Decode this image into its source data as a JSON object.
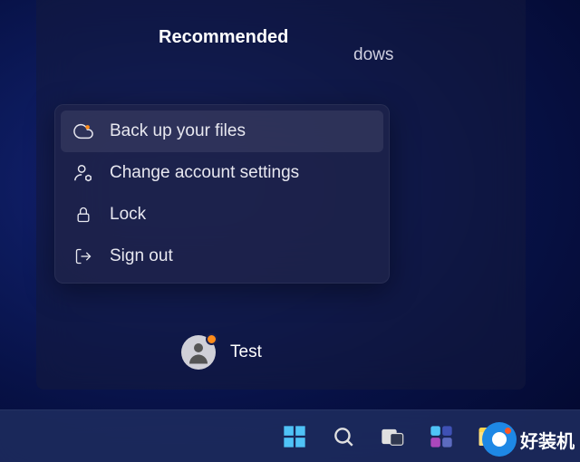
{
  "start": {
    "section_title": "Recommended",
    "partial_visible": "dows"
  },
  "menu": {
    "items": [
      {
        "id": "backup",
        "label": "Back up your files",
        "highlighted": true
      },
      {
        "id": "account",
        "label": "Change account settings",
        "highlighted": false
      },
      {
        "id": "lock",
        "label": "Lock",
        "highlighted": false
      },
      {
        "id": "signout",
        "label": "Sign out",
        "highlighted": false
      }
    ]
  },
  "user": {
    "name": "Test",
    "has_notification": true
  },
  "taskbar": {
    "items": [
      "start",
      "search",
      "taskview",
      "widgets",
      "explorer"
    ]
  },
  "watermark": {
    "text": "好装机"
  }
}
